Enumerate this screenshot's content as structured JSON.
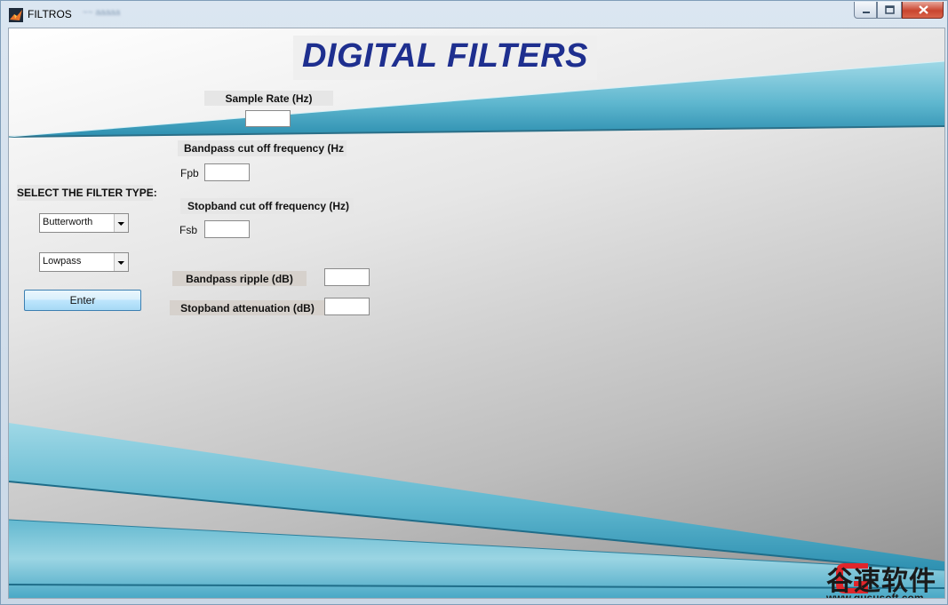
{
  "window": {
    "title": "FILTROS",
    "blurred_title": "~~ aaaaa"
  },
  "heading": "DIGITAL FILTERS",
  "sample_rate": {
    "label": "Sample Rate (Hz)",
    "value": ""
  },
  "bandpass_cutoff": {
    "label": "Bandpass cut off frequency (Hz",
    "field_label": "Fpb",
    "value": ""
  },
  "stopband_cutoff": {
    "label": "Stopband cut off frequency (Hz)",
    "field_label": "Fsb",
    "value": ""
  },
  "bandpass_ripple": {
    "label": "Bandpass ripple (dB)",
    "value": ""
  },
  "stopband_attenuation": {
    "label": "Stopband attenuation (dB)",
    "value": ""
  },
  "filter_type": {
    "label": "SELECT THE FILTER TYPE:",
    "design_value": "Butterworth",
    "response_value": "Lowpass"
  },
  "enter_button": "Enter",
  "watermark": {
    "text": "谷速软件",
    "url": "www.gususoft.com"
  },
  "colors": {
    "accent_teal": "#5fb7cf",
    "heading_blue": "#1e2f8f",
    "watermark_red": "#e0262b"
  },
  "icons": {
    "app": "matlab-figure-icon",
    "minimize": "minimize-icon",
    "maximize": "maximize-icon",
    "close": "close-icon",
    "dropdown": "chevron-down-icon"
  }
}
